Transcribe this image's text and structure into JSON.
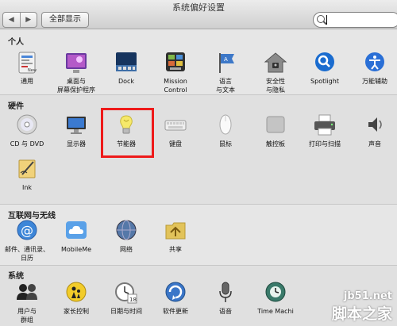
{
  "window": {
    "title": "系统偏好设置",
    "nav_back": "◀",
    "nav_forward": "▶",
    "show_all": "全部显示",
    "search_value": ""
  },
  "sections": {
    "personal": {
      "title": "个人",
      "items": [
        "通用",
        "桌面与\n屏幕保护程序",
        "Dock",
        "Mission\nControl",
        "语言\n与文本",
        "安全性\n与隐私",
        "Spotlight",
        "万能辅助"
      ]
    },
    "hardware": {
      "title": "硬件",
      "items": [
        "CD 与 DVD",
        "显示器",
        "节能器",
        "键盘",
        "鼠标",
        "触控板",
        "打印与扫描",
        "声音",
        "Ink"
      ]
    },
    "internet": {
      "title": "互联网与无线",
      "items": [
        "邮件、通讯录、\n日历",
        "MobileMe",
        "网络",
        "共享"
      ]
    },
    "system": {
      "title": "系统",
      "items": [
        "用户与\n群组",
        "家长控制",
        "日期与时间",
        "软件更新",
        "语音",
        "Time Machi"
      ]
    }
  },
  "watermark": {
    "line1": "jb51.net",
    "line2": "脚本之家"
  },
  "colors": {
    "highlight_border": "#ee1a1a",
    "spotlight_blue": "#1a6ccf",
    "accessibility_blue": "#2a6fd6"
  }
}
